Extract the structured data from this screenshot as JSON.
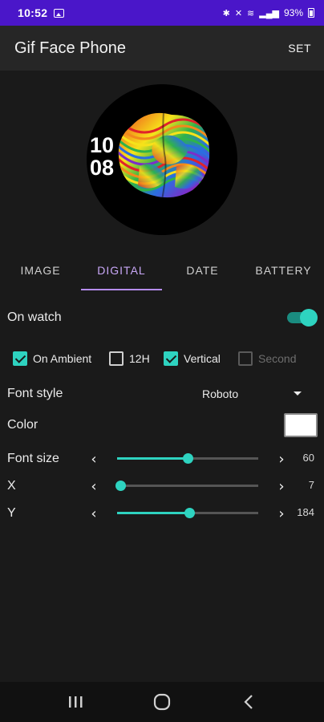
{
  "status": {
    "time": "10:52",
    "battery": "93%"
  },
  "app": {
    "title": "Gif Face Phone",
    "set_label": "SET"
  },
  "preview": {
    "hour": "10",
    "minute": "08"
  },
  "tabs": [
    {
      "label": "IMAGE",
      "active": false
    },
    {
      "label": "DIGITAL",
      "active": true
    },
    {
      "label": "DATE",
      "active": false
    },
    {
      "label": "BATTERY",
      "active": false
    }
  ],
  "settings": {
    "on_watch_label": "On watch",
    "on_watch_enabled": true,
    "checkboxes": [
      {
        "label": "On Ambient",
        "checked": true,
        "enabled": true
      },
      {
        "label": "12H",
        "checked": false,
        "enabled": true
      },
      {
        "label": "Vertical",
        "checked": true,
        "enabled": true
      },
      {
        "label": "Second",
        "checked": false,
        "enabled": false
      }
    ],
    "font_style_label": "Font style",
    "font_style_value": "Roboto",
    "color_label": "Color",
    "color_value": "#ffffff",
    "sliders": [
      {
        "label": "Font size",
        "value": "60",
        "fraction": 0.5
      },
      {
        "label": "X",
        "value": "7",
        "fraction": 0.02
      },
      {
        "label": "Y",
        "value": "184",
        "fraction": 0.51
      }
    ]
  },
  "colors": {
    "accent": "#2ed3c0",
    "tab_active": "#c7a6f5",
    "status_bar": "#4a16c9"
  },
  "icons": {
    "nav_recents": "recents-icon",
    "nav_home": "home-icon",
    "nav_back": "back-icon"
  }
}
